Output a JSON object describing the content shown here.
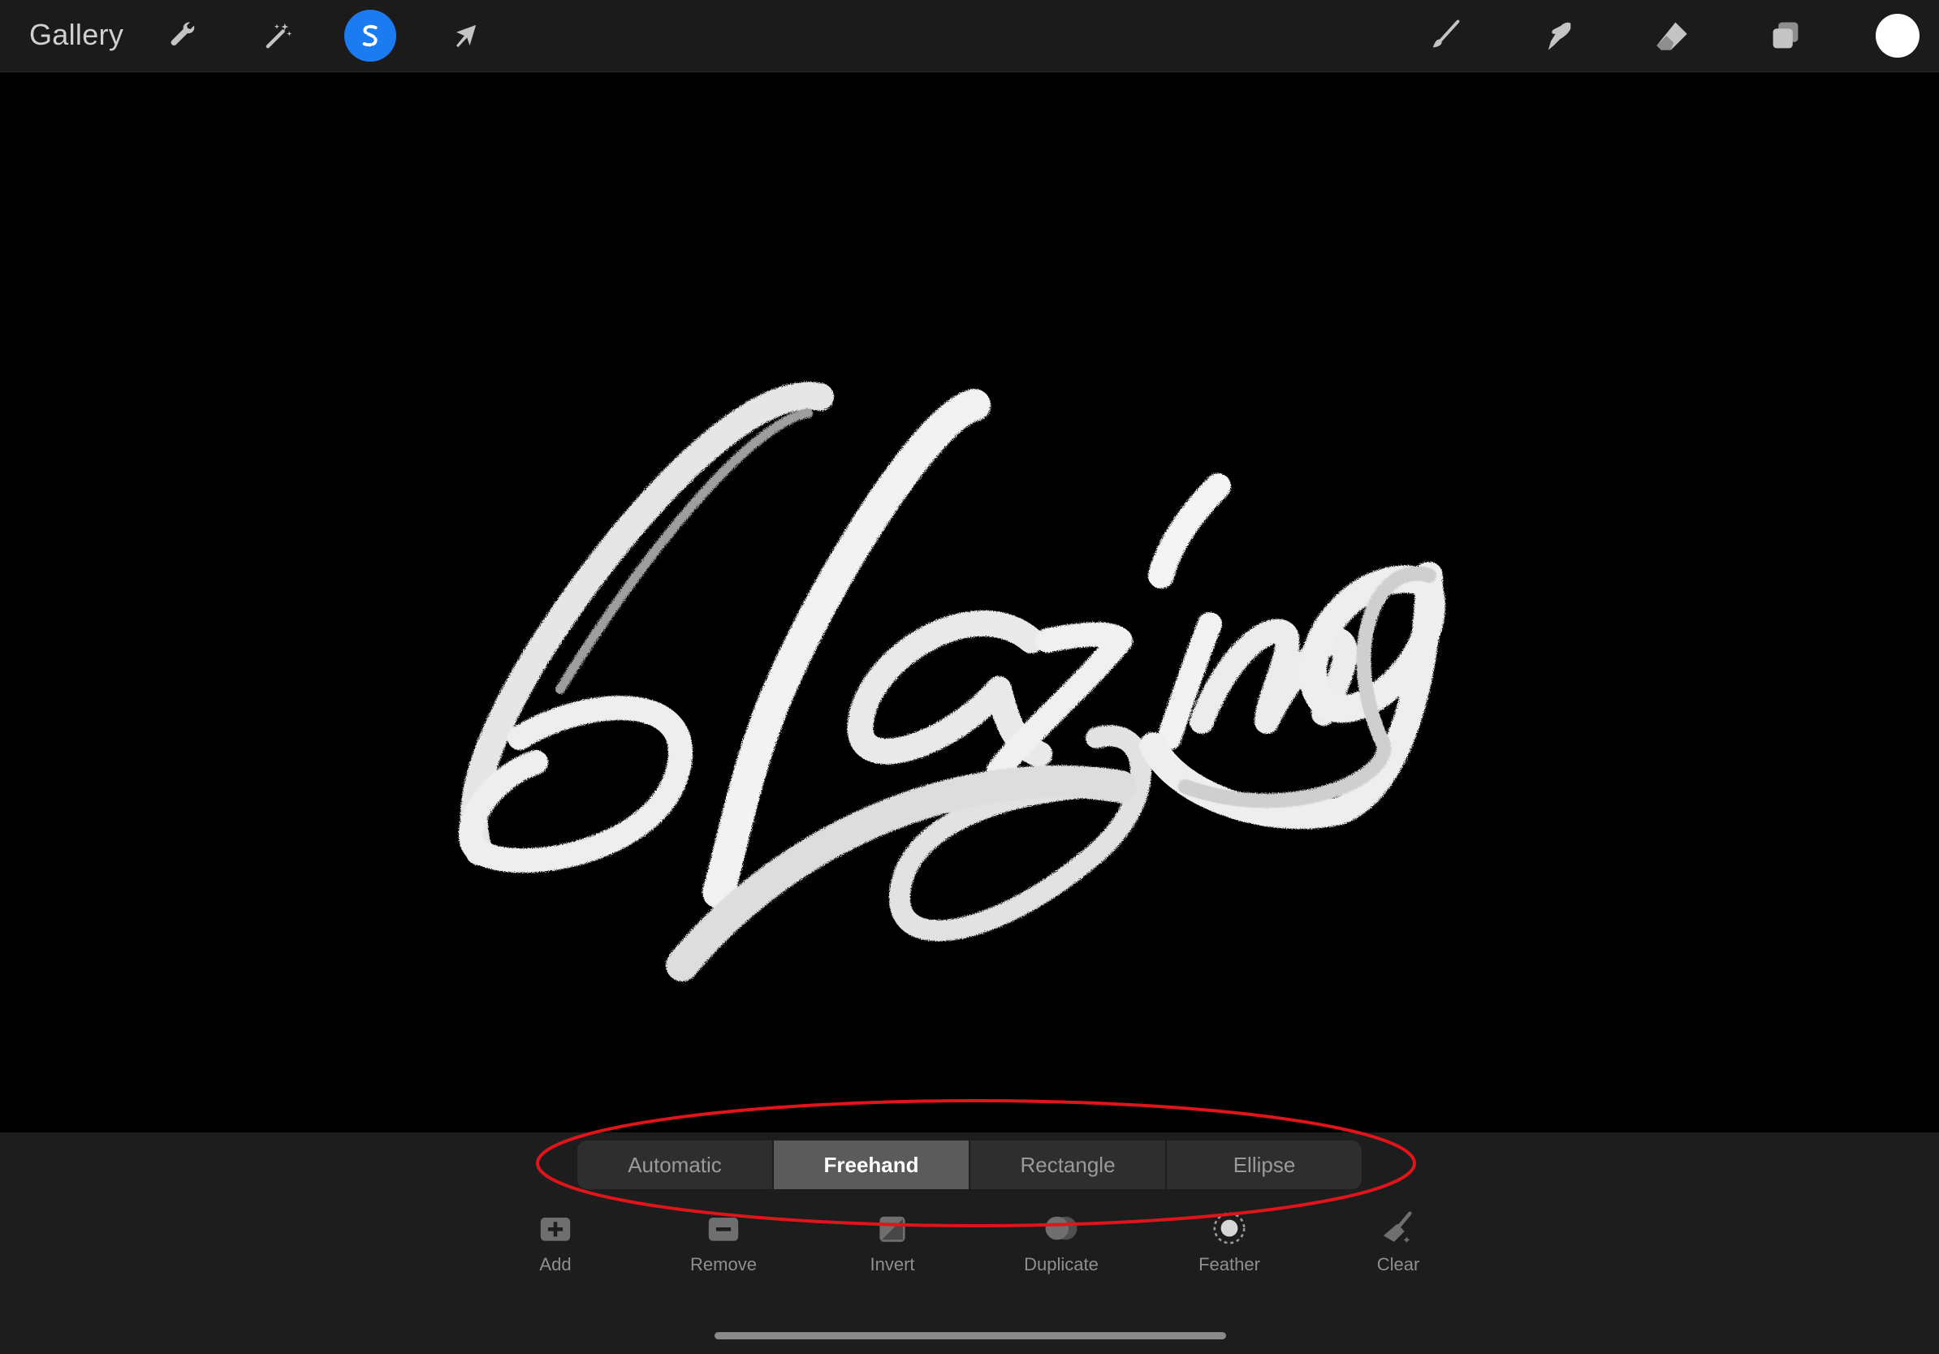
{
  "topbar": {
    "gallery_label": "Gallery",
    "left_tools": [
      {
        "name": "actions",
        "icon": "wrench-icon"
      },
      {
        "name": "adjustments",
        "icon": "magic-wand-icon"
      },
      {
        "name": "selection",
        "icon": "selection-s-icon",
        "active": true
      },
      {
        "name": "transform",
        "icon": "arrow-cursor-icon"
      }
    ],
    "right_tools": [
      {
        "name": "brush",
        "icon": "paintbrush-icon"
      },
      {
        "name": "smudge",
        "icon": "smudge-finger-icon"
      },
      {
        "name": "eraser",
        "icon": "eraser-icon"
      },
      {
        "name": "layers",
        "icon": "layers-icon"
      }
    ],
    "current_color": "#ffffff",
    "active_accent": "#1b7bf0"
  },
  "canvas": {
    "artwork_text": "Blazing",
    "background": "#000000"
  },
  "selection_modes": {
    "items": [
      "Automatic",
      "Freehand",
      "Rectangle",
      "Ellipse"
    ],
    "selected": "Freehand"
  },
  "selection_actions": [
    {
      "label": "Add",
      "icon": "add-square-icon"
    },
    {
      "label": "Remove",
      "icon": "remove-square-icon"
    },
    {
      "label": "Invert",
      "icon": "invert-icon"
    },
    {
      "label": "Duplicate",
      "icon": "duplicate-icon"
    },
    {
      "label": "Feather",
      "icon": "feather-icon"
    },
    {
      "label": "Clear",
      "icon": "clear-broom-icon"
    }
  ],
  "annotation": {
    "color": "#e0141b"
  }
}
